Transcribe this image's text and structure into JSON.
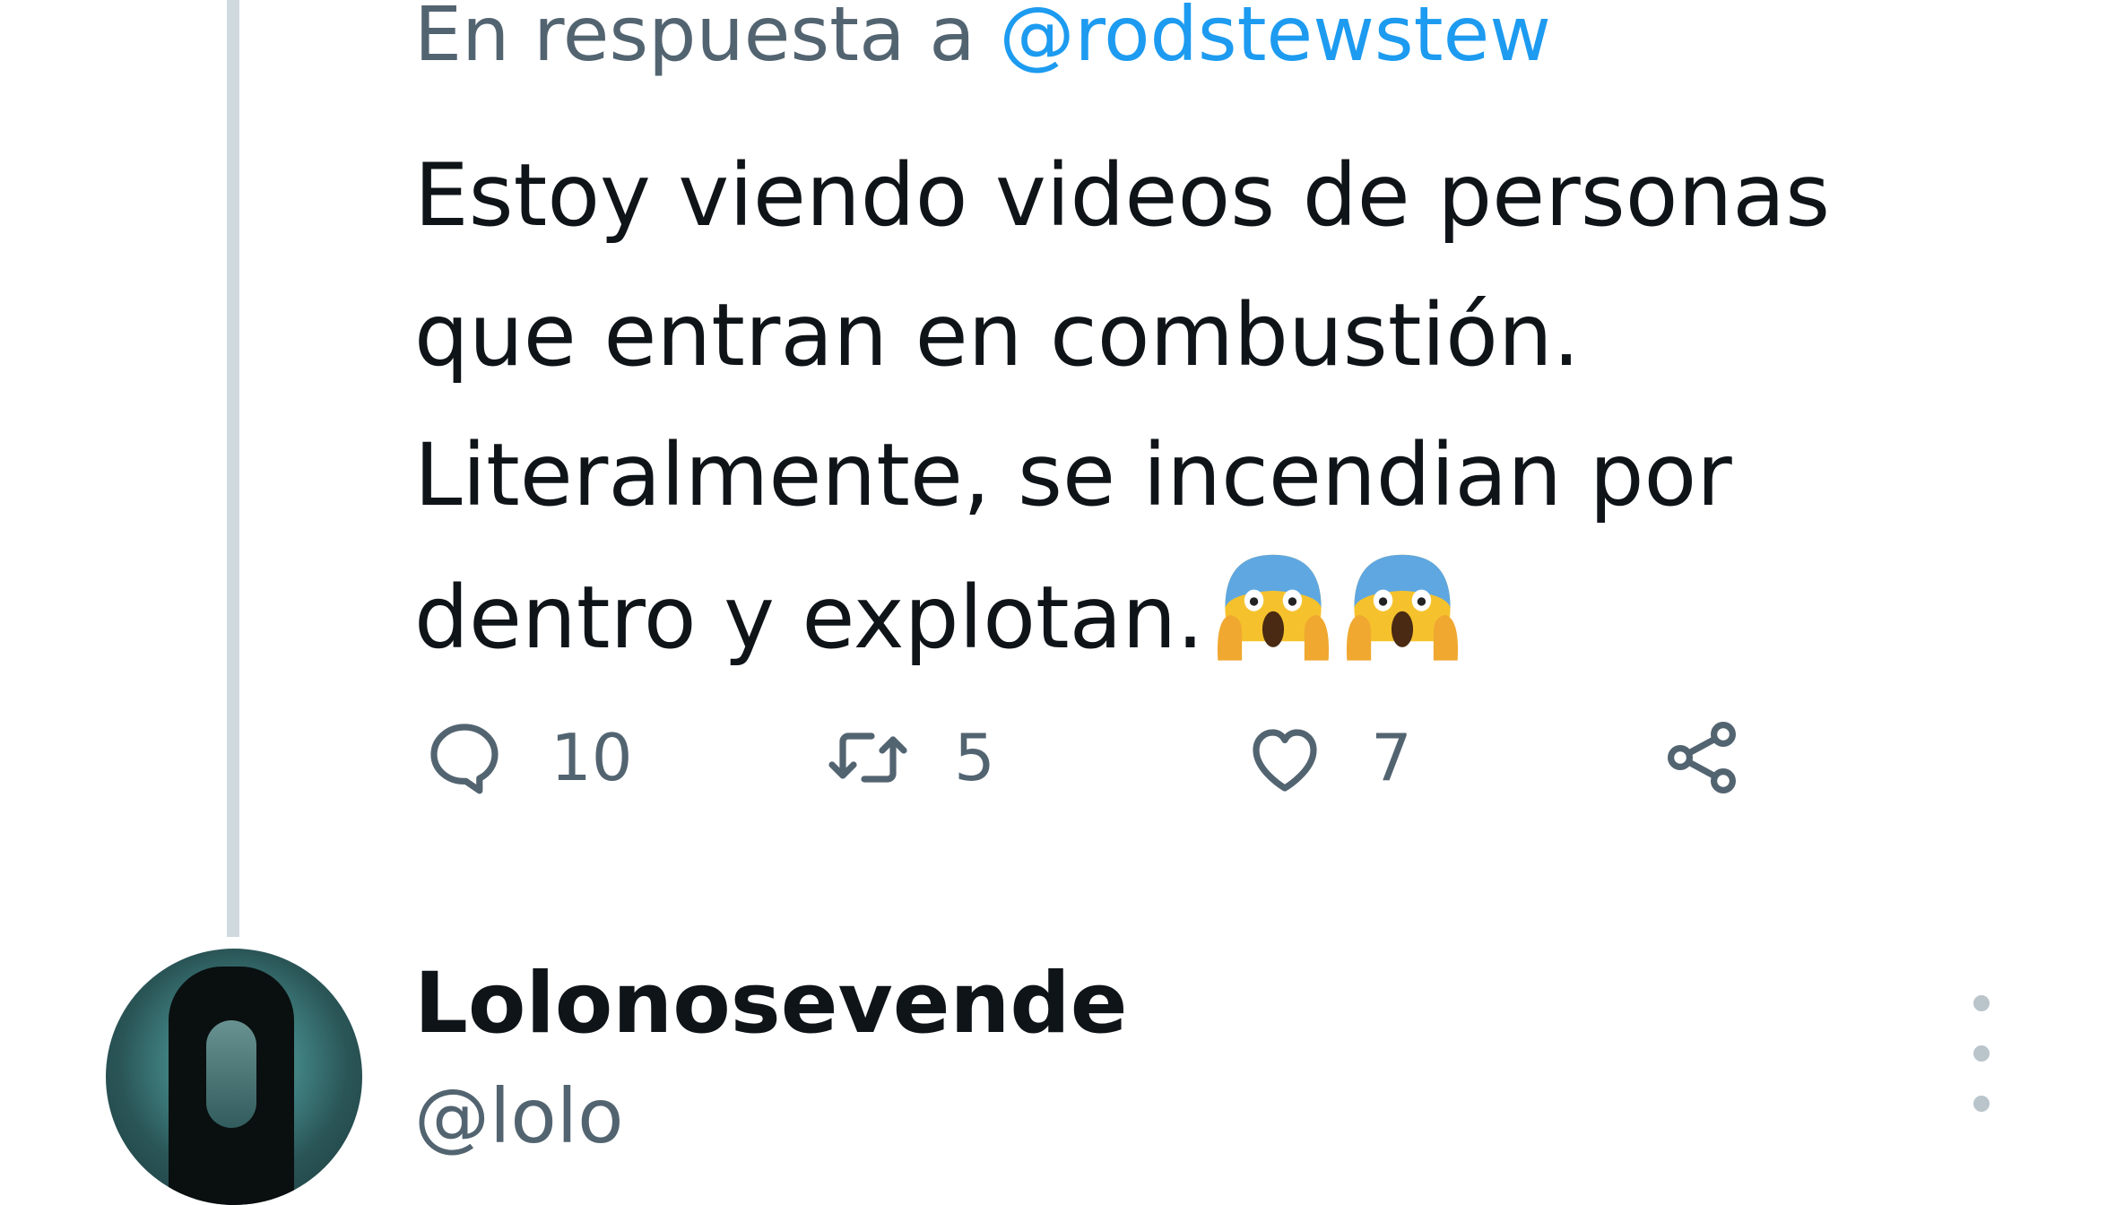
{
  "tweet": {
    "reply_prefix": "En respuesta a ",
    "reply_handle": "@rodstewstew",
    "text_line1": "Estoy viendo videos de personas",
    "text_line2": "que entran en combustión.",
    "text_line3": "Literalmente, se incendian por",
    "text_line4": "dentro y explotan.",
    "emoji_count": 2,
    "emoji_name": "face-screaming-in-fear",
    "actions": {
      "replies": "10",
      "retweets": "5",
      "likes": "7"
    }
  },
  "next_tweet": {
    "display_name": "Lolonosevende",
    "handle": "@lolo"
  },
  "colors": {
    "text": "#0f1419",
    "muted": "#536471",
    "link": "#1d9bf0",
    "thread_line": "#cfd9de"
  }
}
